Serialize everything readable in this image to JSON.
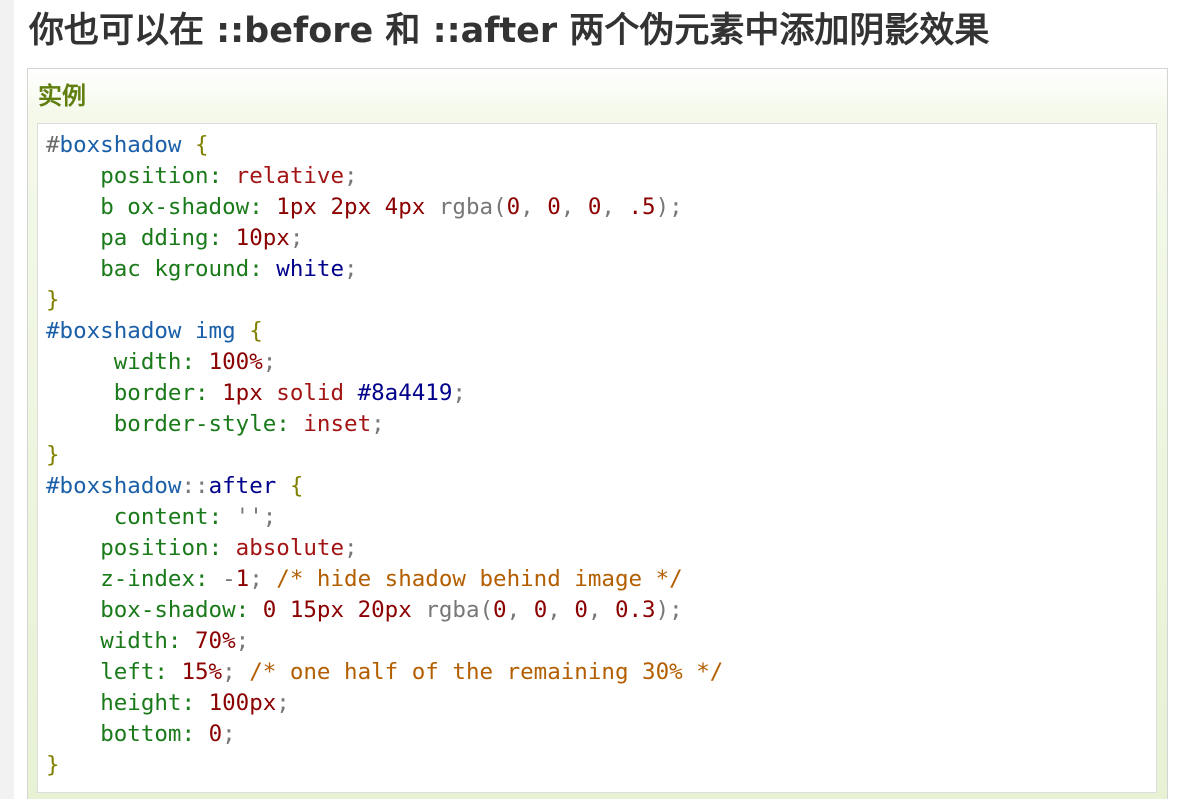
{
  "heading": "你也可以在 ::before 和 ::after 两个伪元素中添加阴影效果",
  "example": {
    "title": "实例",
    "code_lines": [
      [
        {
          "t": "#",
          "c": "hash"
        },
        {
          "t": "boxshadow",
          "c": "sel"
        },
        {
          "t": " ",
          "c": "ws"
        },
        {
          "t": "{",
          "c": "brace"
        }
      ],
      [
        {
          "t": "    ",
          "c": "ws"
        },
        {
          "t": "position",
          "c": "prop"
        },
        {
          "t": ": ",
          "c": "prop"
        },
        {
          "t": "relative",
          "c": "val"
        },
        {
          "t": ";",
          "c": "punc"
        }
      ],
      [
        {
          "t": "    ",
          "c": "ws"
        },
        {
          "t": "b ox-shadow",
          "c": "prop"
        },
        {
          "t": ": ",
          "c": "prop"
        },
        {
          "t": "1px",
          "c": "num"
        },
        {
          "t": " ",
          "c": "ws"
        },
        {
          "t": "2px",
          "c": "num"
        },
        {
          "t": " ",
          "c": "ws"
        },
        {
          "t": "4px",
          "c": "num"
        },
        {
          "t": " ",
          "c": "ws"
        },
        {
          "t": "rgba(",
          "c": "fn"
        },
        {
          "t": "0",
          "c": "num"
        },
        {
          "t": ", ",
          "c": "punc"
        },
        {
          "t": "0",
          "c": "num"
        },
        {
          "t": ", ",
          "c": "punc"
        },
        {
          "t": "0",
          "c": "num"
        },
        {
          "t": ", ",
          "c": "punc"
        },
        {
          "t": ".5",
          "c": "num"
        },
        {
          "t": ");",
          "c": "punc"
        }
      ],
      [
        {
          "t": "    ",
          "c": "ws"
        },
        {
          "t": "pa dding",
          "c": "prop"
        },
        {
          "t": ": ",
          "c": "prop"
        },
        {
          "t": "10px",
          "c": "num"
        },
        {
          "t": ";",
          "c": "punc"
        }
      ],
      [
        {
          "t": "    ",
          "c": "ws"
        },
        {
          "t": "bac kground",
          "c": "prop"
        },
        {
          "t": ": ",
          "c": "prop"
        },
        {
          "t": "white",
          "c": "kw"
        },
        {
          "t": ";",
          "c": "punc"
        }
      ],
      [
        {
          "t": "}",
          "c": "brace"
        }
      ],
      [
        {
          "t": "#boxshadow",
          "c": "sel"
        },
        {
          "t": " ",
          "c": "ws"
        },
        {
          "t": "img",
          "c": "sel"
        },
        {
          "t": " ",
          "c": "ws"
        },
        {
          "t": "{",
          "c": "brace"
        }
      ],
      [
        {
          "t": "     ",
          "c": "ws"
        },
        {
          "t": "width",
          "c": "prop"
        },
        {
          "t": ": ",
          "c": "prop"
        },
        {
          "t": "100%",
          "c": "num"
        },
        {
          "t": ";",
          "c": "punc"
        }
      ],
      [
        {
          "t": "     ",
          "c": "ws"
        },
        {
          "t": "border",
          "c": "prop"
        },
        {
          "t": ": ",
          "c": "prop"
        },
        {
          "t": "1px",
          "c": "num"
        },
        {
          "t": " ",
          "c": "ws"
        },
        {
          "t": "solid",
          "c": "val"
        },
        {
          "t": " ",
          "c": "ws"
        },
        {
          "t": "#8a4419",
          "c": "kw"
        },
        {
          "t": ";",
          "c": "punc"
        }
      ],
      [
        {
          "t": "     ",
          "c": "ws"
        },
        {
          "t": "border-style",
          "c": "prop"
        },
        {
          "t": ": ",
          "c": "prop"
        },
        {
          "t": "inset",
          "c": "val"
        },
        {
          "t": ";",
          "c": "punc"
        }
      ],
      [
        {
          "t": "}",
          "c": "brace"
        }
      ],
      [
        {
          "t": "#boxshadow",
          "c": "sel"
        },
        {
          "t": "::",
          "c": "punc"
        },
        {
          "t": "after",
          "c": "kw"
        },
        {
          "t": " ",
          "c": "ws"
        },
        {
          "t": "{",
          "c": "brace"
        }
      ],
      [
        {
          "t": "     ",
          "c": "ws"
        },
        {
          "t": "content",
          "c": "prop"
        },
        {
          "t": ": ",
          "c": "prop"
        },
        {
          "t": "''",
          "c": "str"
        },
        {
          "t": ";",
          "c": "punc"
        }
      ],
      [
        {
          "t": "    ",
          "c": "ws"
        },
        {
          "t": "position",
          "c": "prop"
        },
        {
          "t": ": ",
          "c": "prop"
        },
        {
          "t": "absolute",
          "c": "val"
        },
        {
          "t": ";",
          "c": "punc"
        }
      ],
      [
        {
          "t": "    ",
          "c": "ws"
        },
        {
          "t": "z-index",
          "c": "prop"
        },
        {
          "t": ": ",
          "c": "prop"
        },
        {
          "t": "-",
          "c": "punc"
        },
        {
          "t": "1",
          "c": "num"
        },
        {
          "t": "; ",
          "c": "punc"
        },
        {
          "t": "/* hide shadow behind image */",
          "c": "com"
        }
      ],
      [
        {
          "t": "    ",
          "c": "ws"
        },
        {
          "t": "box-shadow",
          "c": "prop"
        },
        {
          "t": ": ",
          "c": "prop"
        },
        {
          "t": "0",
          "c": "num"
        },
        {
          "t": " ",
          "c": "ws"
        },
        {
          "t": "15px",
          "c": "num"
        },
        {
          "t": " ",
          "c": "ws"
        },
        {
          "t": "20px",
          "c": "num"
        },
        {
          "t": " ",
          "c": "ws"
        },
        {
          "t": "rgba(",
          "c": "fn"
        },
        {
          "t": "0",
          "c": "num"
        },
        {
          "t": ", ",
          "c": "punc"
        },
        {
          "t": "0",
          "c": "num"
        },
        {
          "t": ", ",
          "c": "punc"
        },
        {
          "t": "0",
          "c": "num"
        },
        {
          "t": ", ",
          "c": "punc"
        },
        {
          "t": "0.3",
          "c": "num"
        },
        {
          "t": ");",
          "c": "punc"
        }
      ],
      [
        {
          "t": "    ",
          "c": "ws"
        },
        {
          "t": "width",
          "c": "prop"
        },
        {
          "t": ": ",
          "c": "prop"
        },
        {
          "t": "70%",
          "c": "num"
        },
        {
          "t": ";",
          "c": "punc"
        }
      ],
      [
        {
          "t": "    ",
          "c": "ws"
        },
        {
          "t": "left",
          "c": "prop"
        },
        {
          "t": ": ",
          "c": "prop"
        },
        {
          "t": "15%",
          "c": "num"
        },
        {
          "t": "; ",
          "c": "punc"
        },
        {
          "t": "/* one half of the remaining 30% */",
          "c": "com"
        }
      ],
      [
        {
          "t": "    ",
          "c": "ws"
        },
        {
          "t": "height",
          "c": "prop"
        },
        {
          "t": ": ",
          "c": "prop"
        },
        {
          "t": "100px",
          "c": "num"
        },
        {
          "t": ";",
          "c": "punc"
        }
      ],
      [
        {
          "t": "    ",
          "c": "ws"
        },
        {
          "t": "bottom",
          "c": "prop"
        },
        {
          "t": ": ",
          "c": "prop"
        },
        {
          "t": "0",
          "c": "num"
        },
        {
          "t": ";",
          "c": "punc"
        }
      ],
      [
        {
          "t": "}",
          "c": "brace"
        }
      ]
    ]
  },
  "colors": {
    "heading": "#333333",
    "example_title": "#617f10",
    "selector": "#1b5fa8",
    "property": "#1a7a1a",
    "keyword_value": "#a31515",
    "number": "#8b0000",
    "named_value": "#00008b",
    "brace": "#808000",
    "comment": "#b35e00",
    "punctuation": "#777777"
  }
}
